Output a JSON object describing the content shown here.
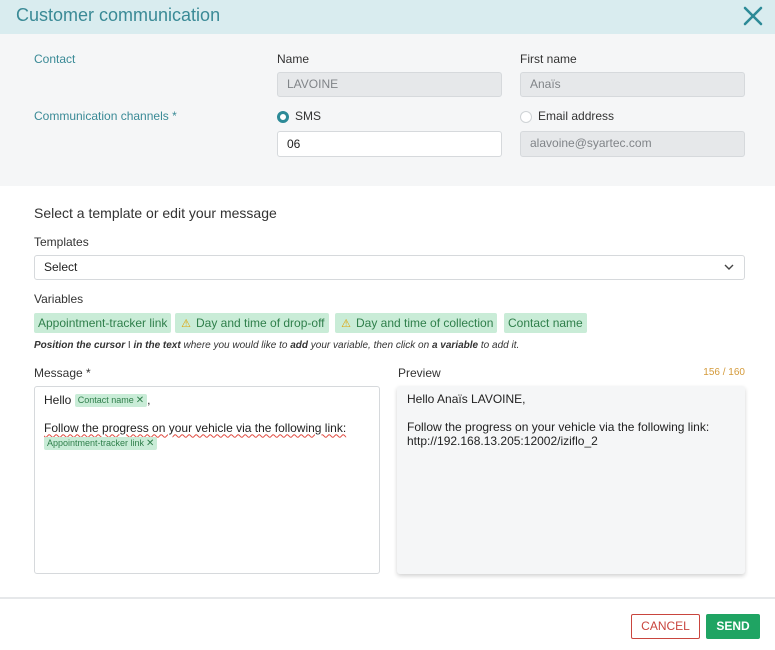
{
  "dialog": {
    "title": "Customer communication"
  },
  "contact": {
    "label": "Contact",
    "name_label": "Name",
    "name_value": "LAVOINE",
    "firstname_label": "First name",
    "firstname_value": "Anaïs"
  },
  "channels": {
    "label": "Communication channels *",
    "sms_label": "SMS",
    "sms_value": "06",
    "sms_selected": true,
    "email_label": "Email address",
    "email_value": "alavoine@syartec.com"
  },
  "template_section": {
    "title": "Select a template or edit your message",
    "templates_label": "Templates",
    "templates_selected": "Select",
    "variables_label": "Variables",
    "variables": [
      {
        "label": "Appointment-tracker link",
        "warning": false
      },
      {
        "label": "Day and time of drop-off",
        "warning": true
      },
      {
        "label": "Day and time of collection",
        "warning": true
      },
      {
        "label": "Contact name",
        "warning": false
      }
    ],
    "hint": {
      "p1": "Position the cursor",
      "cursor_glyph": "I",
      "p2": "in the text",
      "p3": "where you would like to",
      "p4": "add",
      "p5": "your variable, then click on",
      "p6": "a variable",
      "p7": "to add it."
    }
  },
  "message": {
    "label": "Message *",
    "greeting": "Hello",
    "chip_contact": "Contact name",
    "after_chip": ",",
    "body_line": "Follow the progress on your vehicle via the following link:",
    "chip_link": "Appointment-tracker link"
  },
  "preview": {
    "label": "Preview",
    "counter": "156 / 160",
    "line1": "Hello Anaïs LAVOINE,",
    "line2": "Follow the progress on your vehicle via the following link:",
    "line3": "http://192.168.13.205:12002/iziflo_2"
  },
  "footer": {
    "cancel_label": "CANCEL",
    "send_label": "SEND"
  },
  "colors": {
    "header_bg": "#d9ecef",
    "accent_teal": "#3a8a96",
    "chip_bg": "#c9ecd7",
    "send_green": "#1fa463",
    "cancel_red": "#c9453e",
    "counter_orange": "#d49a3a"
  },
  "icons": {
    "close": "close-icon",
    "chevron": "chevron-down-icon",
    "warning": "warning-icon",
    "remove_chip": "remove-chip-icon"
  }
}
